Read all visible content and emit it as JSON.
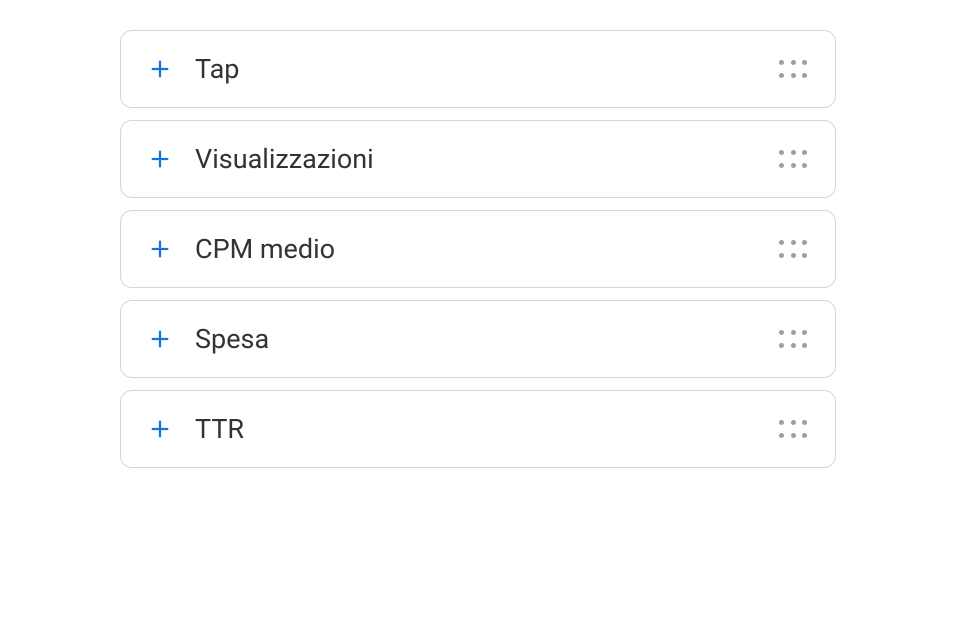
{
  "metrics": [
    {
      "label": "Tap"
    },
    {
      "label": "Visualizzazioni"
    },
    {
      "label": "CPM medio"
    },
    {
      "label": "Spesa"
    },
    {
      "label": "TTR"
    }
  ]
}
